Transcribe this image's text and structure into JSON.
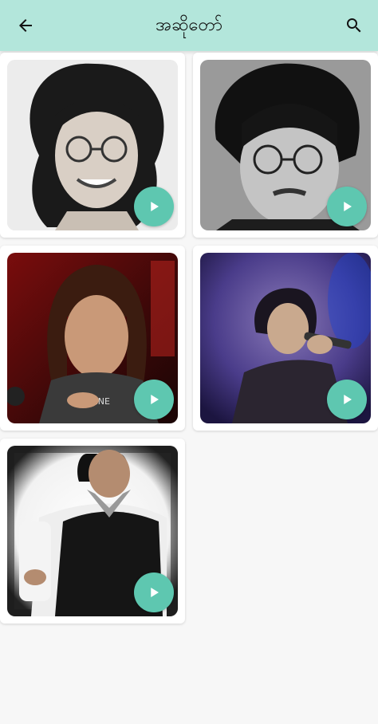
{
  "appbar": {
    "title": "အဆိုတော်",
    "back_icon": "arrow-back-icon",
    "search_icon": "search-icon",
    "color": "#b3e6db"
  },
  "artists": [
    {
      "photo": "portrait-sketch"
    },
    {
      "photo": "portrait-bw-glasses"
    },
    {
      "photo": "portrait-long-hair-red"
    },
    {
      "photo": "portrait-singing-purple"
    },
    {
      "photo": "portrait-vest"
    }
  ],
  "play_icon": "play-icon",
  "play_color": "#5ec7b0"
}
